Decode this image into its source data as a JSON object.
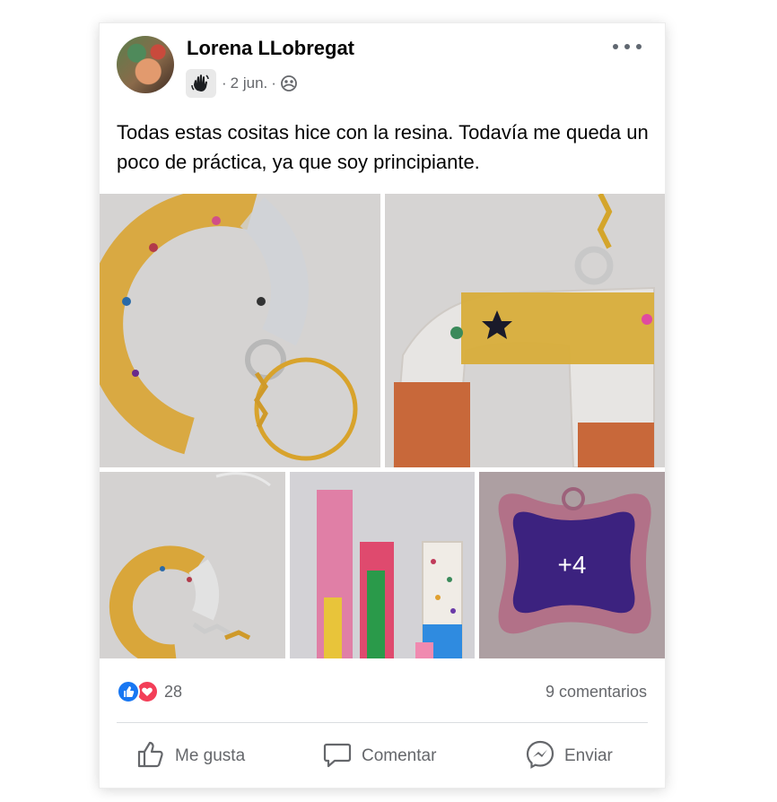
{
  "post": {
    "author": "Lorena LLobregat",
    "date": "2 jun.",
    "separator": "·",
    "text": "Todas estas cositas hice con la resina. Todavía me queda un poco de práctica, ya que soy principiante.",
    "group_badge_icon": "wave-hand-icon",
    "audience_icon": "group-audience-icon"
  },
  "photos": {
    "count": 5,
    "more_overlay": "+4"
  },
  "reactions": {
    "count": "28",
    "types": [
      "like",
      "love"
    ],
    "like_color": "#1877f2",
    "love_color": "#f33e58"
  },
  "comments_label": "9 comentarios",
  "actions": {
    "like": "Me gusta",
    "comment": "Comentar",
    "send": "Enviar"
  }
}
